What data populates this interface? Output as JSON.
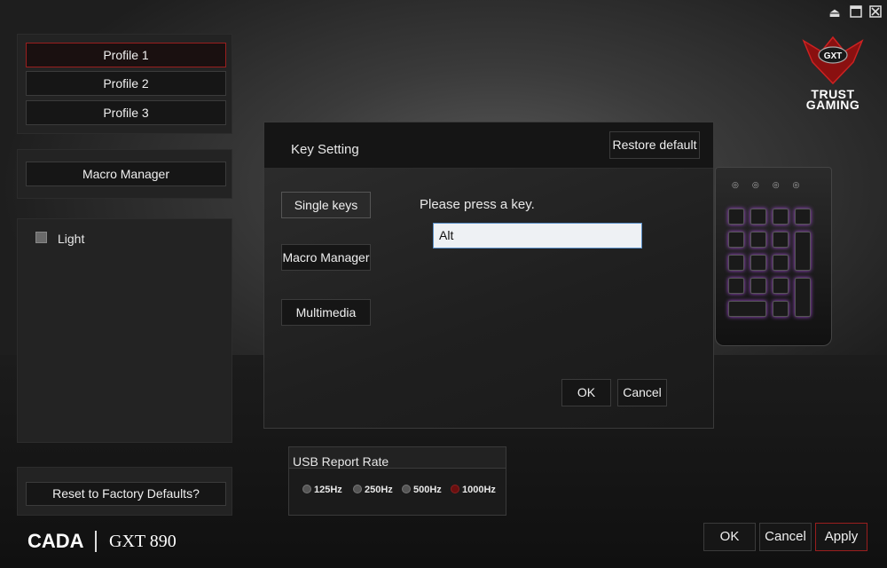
{
  "window": {
    "controls": {
      "minimize_icon": "eject-icon",
      "restore_icon": "minimize-icon",
      "close_icon": "close-icon"
    }
  },
  "logo": {
    "line1": "TRUST",
    "line2": "GAMING",
    "badge": "GXT"
  },
  "profiles": [
    {
      "label": "Profile 1",
      "active": true
    },
    {
      "label": "Profile 2",
      "active": false
    },
    {
      "label": "Profile 3",
      "active": false
    }
  ],
  "sidebar": {
    "macro_manager": "Macro Manager",
    "light_label": "Light",
    "reset_label": "Reset to Factory Defaults?"
  },
  "dialog": {
    "title": "Key Setting",
    "restore_default": "Restore default",
    "tabs": [
      "Single keys",
      "Macro Manager",
      "Multimedia"
    ],
    "prompt": "Please press a key.",
    "key_value": "Alt",
    "ok": "OK",
    "cancel": "Cancel"
  },
  "usb": {
    "title": "USB Report Rate",
    "options": [
      "125Hz",
      "250Hz",
      "500Hz",
      "1000Hz"
    ],
    "selected": "1000Hz"
  },
  "footer": {
    "brand": "CADA",
    "model": "GXT 890",
    "ok": "OK",
    "cancel": "Cancel",
    "apply": "Apply"
  },
  "colors": {
    "accent": "#9a1e1e",
    "key_glow": "#a64bd8"
  }
}
